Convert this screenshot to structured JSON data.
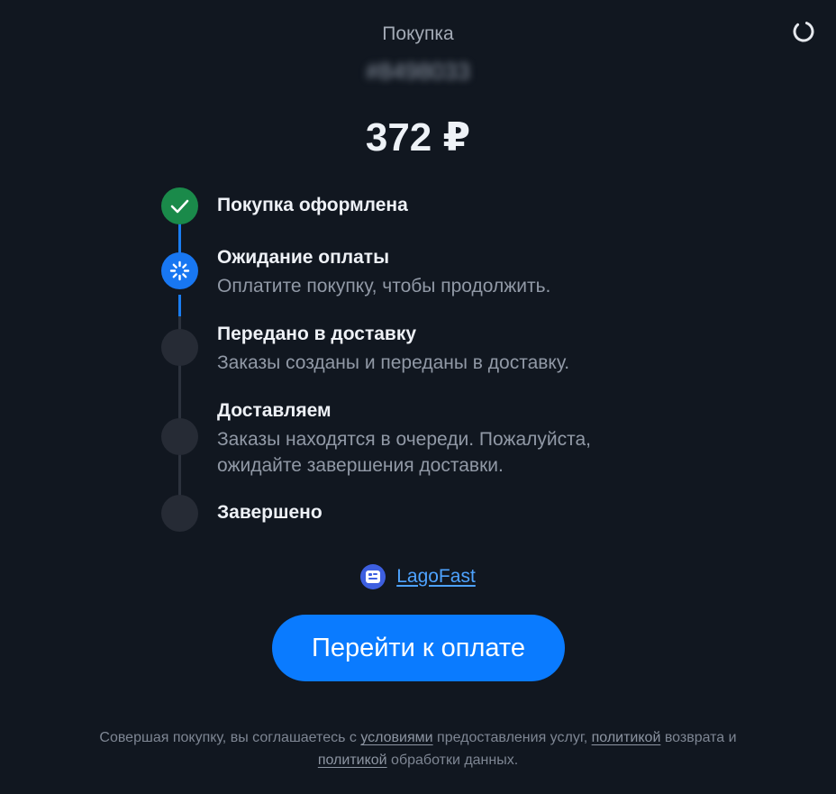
{
  "header": {
    "title": "Покупка",
    "order_id": "#8498033",
    "amount": "372 ₽"
  },
  "steps": [
    {
      "title": "Покупка оформлена",
      "description": "",
      "state": "done"
    },
    {
      "title": "Ожидание оплаты",
      "description": "Оплатите покупку, чтобы продолжить.",
      "state": "active"
    },
    {
      "title": "Передано в доставку",
      "description": "Заказы созданы и переданы в доставку.",
      "state": "pending"
    },
    {
      "title": "Доставляем",
      "description": "Заказы находятся в очереди. Пожалуйста, ожидайте завершения доставки.",
      "state": "pending"
    },
    {
      "title": "Завершено",
      "description": "",
      "state": "pending"
    }
  ],
  "brand": {
    "name": "LagoFast",
    "icon": "lagofast-logo-icon"
  },
  "pay_button": {
    "label": "Перейти к оплате"
  },
  "footer": {
    "text_1": "Совершая покупку, вы соглашаетесь с ",
    "link_terms": "условиями",
    "text_2": " предоставления услуг, ",
    "link_refund": "политикой",
    "text_3": " возврата и ",
    "link_privacy": "политикой",
    "text_4": " обработки данных."
  },
  "colors": {
    "background": "#111720",
    "accent": "#0a7bff",
    "success": "#1a8a4a"
  }
}
